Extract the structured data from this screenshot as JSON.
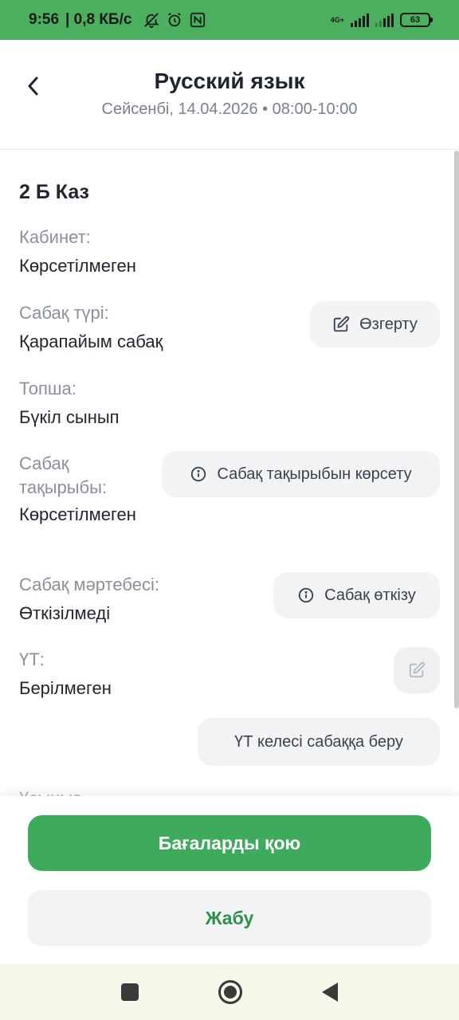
{
  "status_bar": {
    "time": "9:56",
    "speed": "| 0,8 КБ/с",
    "network": "4G+",
    "battery": "63",
    "icons": [
      "mute-icon",
      "alarm-icon",
      "nfc-icon",
      "signal-icon",
      "battery-icon"
    ]
  },
  "header": {
    "title": "Русский язык",
    "subtitle": "Сейсенбі, 14.04.2026 • 08:00-10:00"
  },
  "lesson": {
    "class_name": "2 Б Каз",
    "fields": [
      {
        "label": "Кабинет:",
        "value": "Көрсетілмеген"
      },
      {
        "label": "Сабақ түрі:",
        "value": "Қарапайым сабақ"
      },
      {
        "label": "Топша:",
        "value": "Бүкіл сынып"
      },
      {
        "label": "Сабақ тақырыбы:",
        "value": "Көрсетілмеген"
      },
      {
        "label": "Сабақ мәртебесі:",
        "value": "Өткізілмеді"
      },
      {
        "label": "ҮТ:",
        "value": "Берілмеген"
      }
    ],
    "fade_text": "Ұсыныс"
  },
  "actions": {
    "change": "Өзгерту",
    "show_topic": "Сабақ тақырыбын көрсету",
    "conduct": "Сабақ өткізу",
    "homework_next": "ҮТ келесі сабаққа беру"
  },
  "bottom": {
    "grade_button": "Бағаларды қою",
    "close_button": "Жабу"
  },
  "colors": {
    "status_bar": "#4caf5f",
    "primary": "#3daa5c",
    "secondary_text": "#2f8f4c"
  }
}
